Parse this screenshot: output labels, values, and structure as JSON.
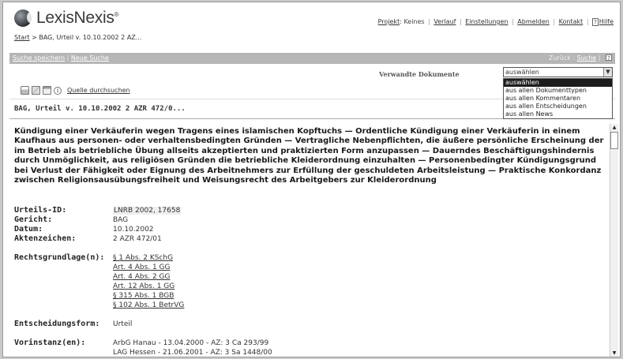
{
  "header": {
    "logo_text": "LexisNexis",
    "logo_tm": "®",
    "breadcrumb_start": "Start",
    "breadcrumb_current": " > BAG, Urteil v. 10.10.2002 2 AZ...",
    "project_label": "Projekt",
    "project_value": ": Keines",
    "links": [
      "Verlauf",
      "Einstellungen",
      "Abmelden",
      "Kontakt"
    ],
    "help_box": "?",
    "help_label": "Hilfe"
  },
  "toolbar": {
    "save_search": "Suche speichern",
    "new_search": "Neue Suche",
    "back_label": "Zurück : ",
    "back_link": "Suche",
    "help_icon": "?"
  },
  "related": {
    "label": "Verwandte Dokumente",
    "selected": "auswählen",
    "options": [
      "auswählen",
      "aus allen Dokumenttypen",
      "aus allen Kommentaren",
      "aus allen Entscheidungen",
      "aus allen News"
    ]
  },
  "doc_tools": {
    "icons": [
      "print-icon",
      "mail-icon",
      "save-icon",
      "info-icon"
    ],
    "info_glyph": "i",
    "source_link": "Quelle durchsuchen"
  },
  "document": {
    "subtitle": "BAG, Urteil v. 10.10.2002 2 AZR 472/0...",
    "headnote": "Kündigung einer Verkäuferin wegen Tragens eines islamischen Kopftuchs — Ordentliche Kündigung einer Verkäuferin in einem Kaufhaus aus personen- oder verhaltensbedingten Gründen — Vertragliche Nebenpflichten, die äußere persönliche Erscheinung der im Betrieb als betriebliche Übung allseits akzeptierten und praktizierten Form anzupassen — Dauerndes Beschäftigungshindernis durch Unmöglichkeit, aus religiösen Gründen die betriebliche Kleiderordnung einzuhalten — Personenbedingter Kündigungsgrund bei Verlust der Fähigkeit oder Eignung des Arbeitnehmers zur Erfüllung der geschuldeten Arbeitsleistung — Praktische Konkordanz zwischen Religionsausübungsfreiheit und Weisungsrecht des Arbeitgebers zur Kleiderordnung",
    "fields": {
      "urteils_id_label": "Urteils-ID:",
      "urteils_id": "LNRB 2002, 17658",
      "gericht_label": "Gericht:",
      "gericht": "BAG",
      "datum_label": "Datum:",
      "datum": "10.10.2002",
      "aktenzeichen_label": "Aktenzeichen:",
      "aktenzeichen": "2 AZR 472/01",
      "rechtsgrundlage_label": "Rechtsgrundlage(n):",
      "rechtsgrundlagen": [
        "§ 1 Abs. 2 KSchG",
        "Art. 4 Abs. 1 GG",
        "Art. 4 Abs. 2 GG",
        "Art. 12 Abs. 1 GG",
        "§ 315 Abs. 1 BGB",
        "§ 102 Abs. 1 BetrVG"
      ],
      "entscheidungsform_label": "Entscheidungsform:",
      "entscheidungsform": "Urteil",
      "vorinstanz_label": "Vorinstanz(en):",
      "vorinstanzen": [
        "ArbG Hanau - 13.04.2000 - AZ: 3 Ca 293/99",
        "LAG Hessen - 21.06.2001 - AZ: 3 Sa 1448/00"
      ]
    }
  }
}
